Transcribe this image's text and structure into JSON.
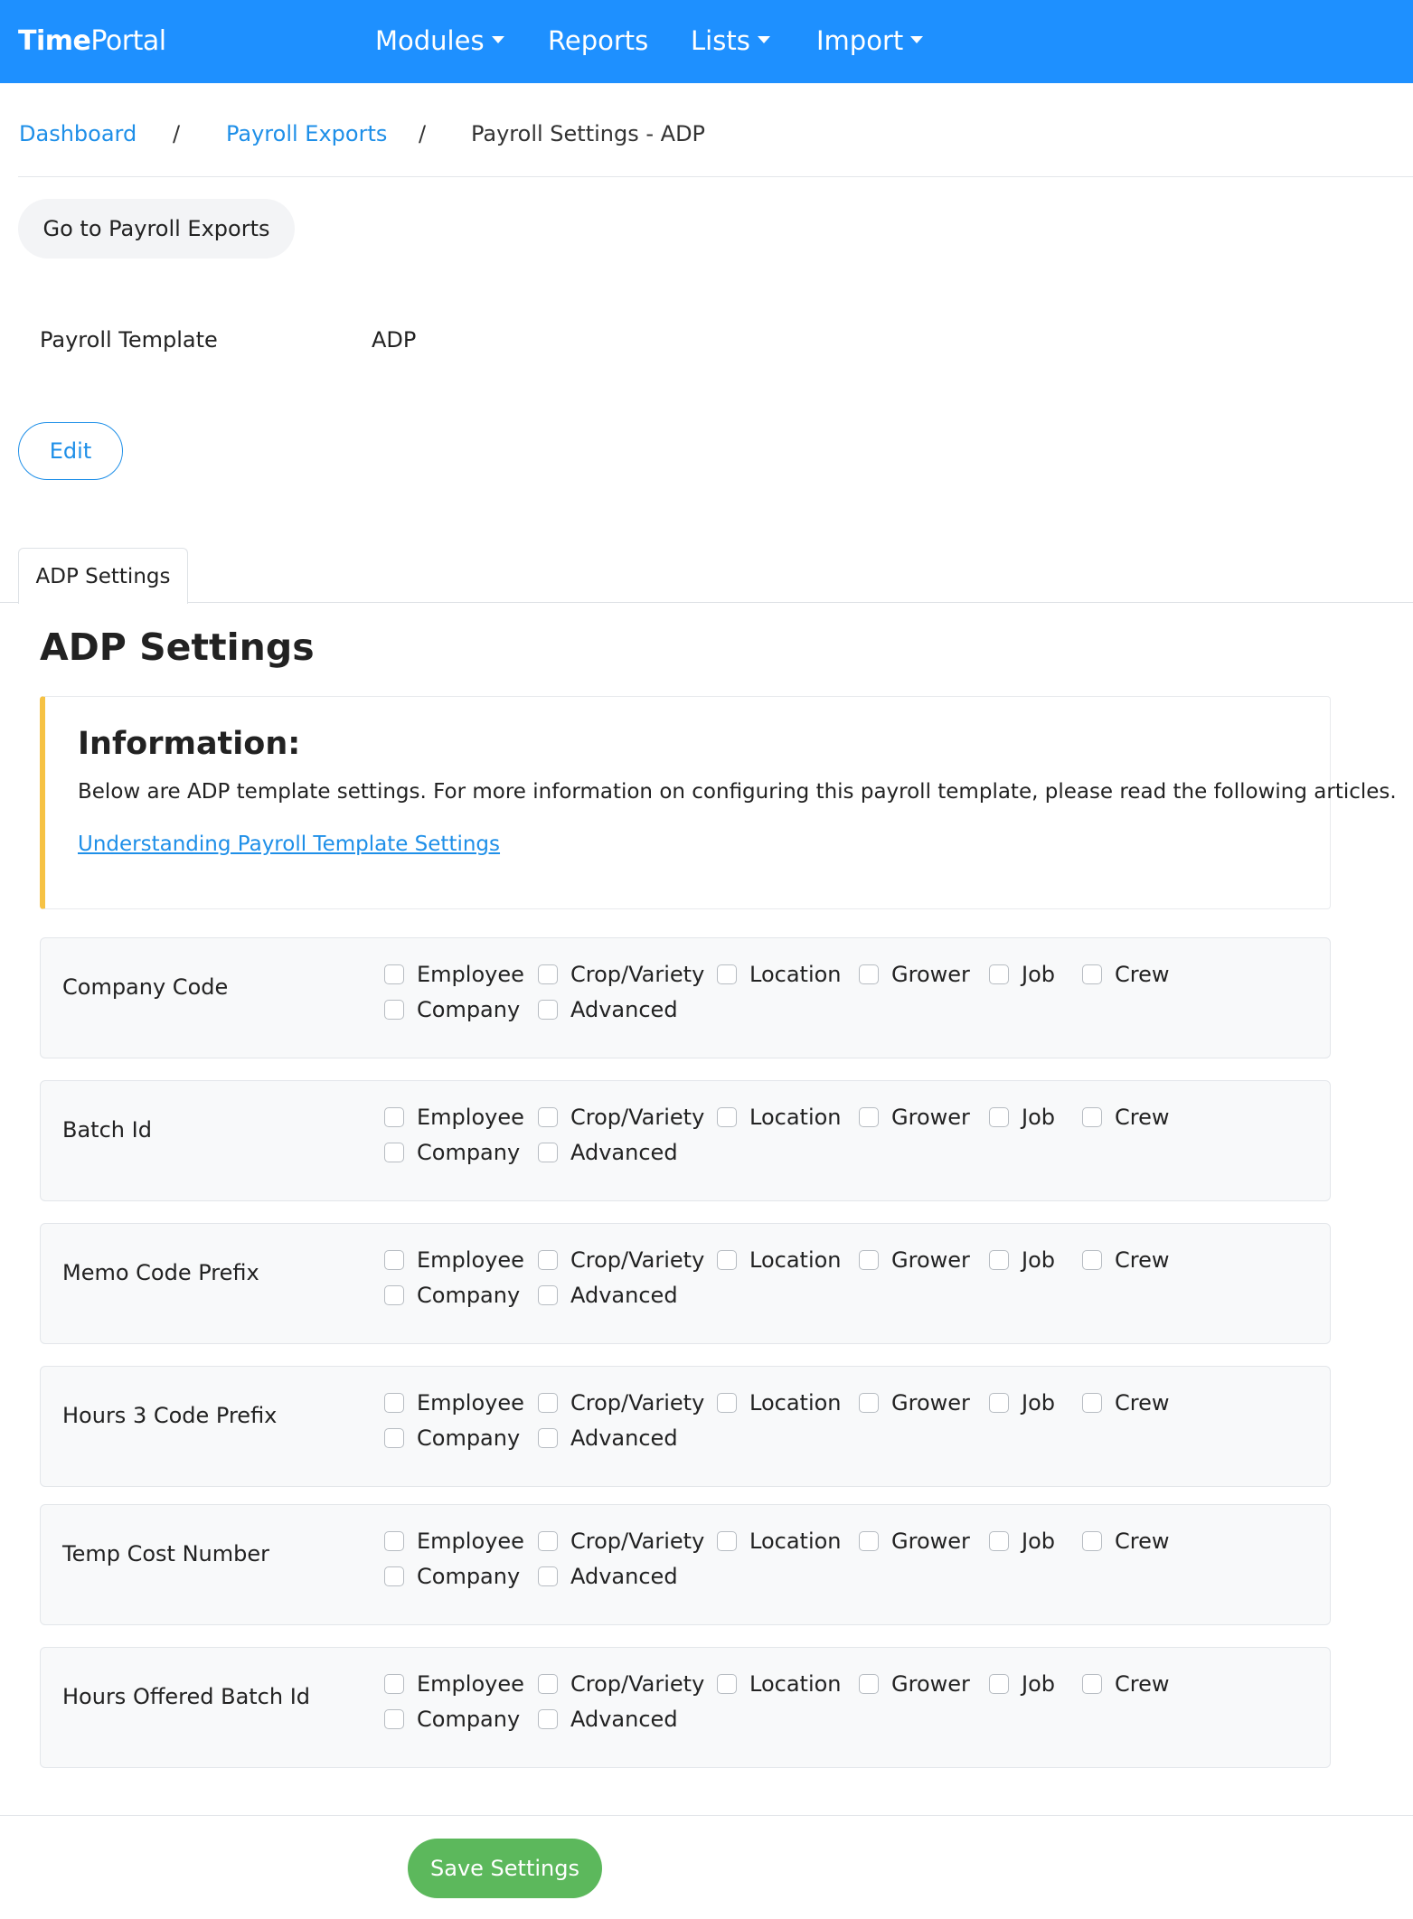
{
  "navbar": {
    "brand_bold": "Time",
    "brand_rest": "Portal",
    "items": [
      {
        "label": "Modules"
      },
      {
        "label": "Reports"
      },
      {
        "label": "Lists"
      },
      {
        "label": "Import"
      }
    ]
  },
  "breadcrumb": {
    "items": [
      "Dashboard",
      "Payroll Exports",
      "Payroll Settings - ADP"
    ],
    "separator": "/"
  },
  "actions": {
    "go_to_payroll_exports": "Go to Payroll Exports",
    "edit": "Edit",
    "save_settings": "Save Settings"
  },
  "template": {
    "label": "Payroll Template",
    "value": "ADP"
  },
  "tabs": [
    {
      "label": "ADP Settings",
      "active": true
    }
  ],
  "section_title": "ADP Settings",
  "info": {
    "title": "Information:",
    "text": "Below are ADP template settings. For more information on configuring this payroll template, please read the following articles.",
    "link": "Understanding Payroll Template Settings"
  },
  "options": [
    "Employee",
    "Crop/Variety",
    "Location",
    "Grower",
    "Job",
    "Crew",
    "Company",
    "Advanced"
  ],
  "settings": [
    {
      "label": "Company Code"
    },
    {
      "label": "Batch Id"
    },
    {
      "label": "Memo Code Prefix"
    },
    {
      "label": "Hours 3 Code Prefix"
    },
    {
      "label": "Temp Cost Number"
    },
    {
      "label": "Hours Offered Batch Id"
    }
  ],
  "colors": {
    "navbar": "#1e90ff",
    "link": "#1e8fe8",
    "info_accent": "#f6c244",
    "save_button": "#5cb85c"
  }
}
